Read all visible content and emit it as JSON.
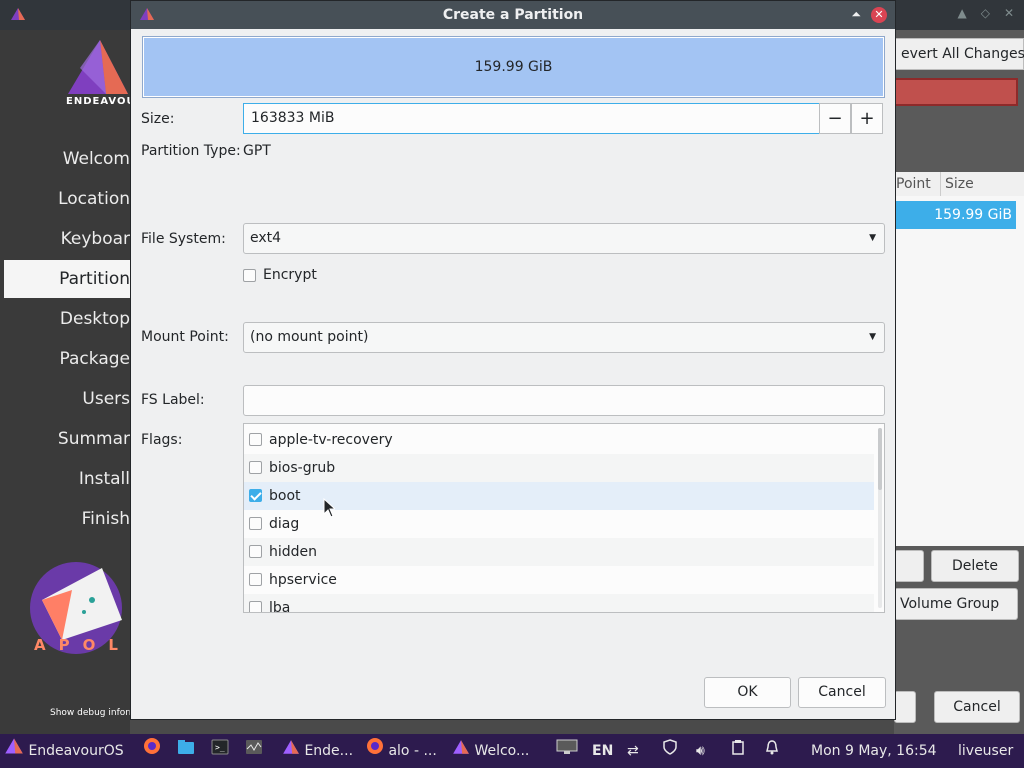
{
  "background": {
    "sidebar_items": [
      "Welcom",
      "Location",
      "Keyboar",
      "Partition",
      "Desktop",
      "Package",
      "Users",
      "Summar",
      "Install",
      "Finish"
    ],
    "active_index": 3,
    "brand_text": "ENDEAVOUR",
    "apollo_text": "APOL",
    "debug_text": "Show debug inform",
    "revert_label": "evert All Changes",
    "table_header_mount": "Point",
    "table_header_size": "Size",
    "table_row_size": "159.99 GiB",
    "delete_label": "Delete",
    "volume_group_label": "Volume Group",
    "cancel_label": "Cancel"
  },
  "dialog": {
    "title": "Create a Partition",
    "preview_text": "159.99 GiB",
    "size_label": "Size:",
    "size_value": "163833 MiB",
    "minus": "−",
    "plus": "+",
    "partition_type_label": "Partition Type:",
    "partition_type_value": "GPT",
    "filesystem_label": "File System:",
    "filesystem_value": "ext4",
    "encrypt_label": "Encrypt",
    "encrypt_checked": false,
    "mount_label": "Mount Point:",
    "mount_value": "(no mount point)",
    "fslabel_label": "FS Label:",
    "fslabel_value": "",
    "flags_label": "Flags:",
    "flags": [
      {
        "name": "apple-tv-recovery",
        "checked": false
      },
      {
        "name": "bios-grub",
        "checked": false
      },
      {
        "name": "boot",
        "checked": true
      },
      {
        "name": "diag",
        "checked": false
      },
      {
        "name": "hidden",
        "checked": false
      },
      {
        "name": "hpservice",
        "checked": false
      },
      {
        "name": "lba",
        "checked": false
      }
    ],
    "ok_label": "OK",
    "cancel_label": "Cancel"
  },
  "taskbar": {
    "start_label": "EndeavourOS",
    "task1": "Ende...",
    "task2": "alo - ...",
    "task3": "Welco...",
    "lang": "EN",
    "clock": "Mon  9 May, 16:54",
    "user": "liveuser"
  }
}
